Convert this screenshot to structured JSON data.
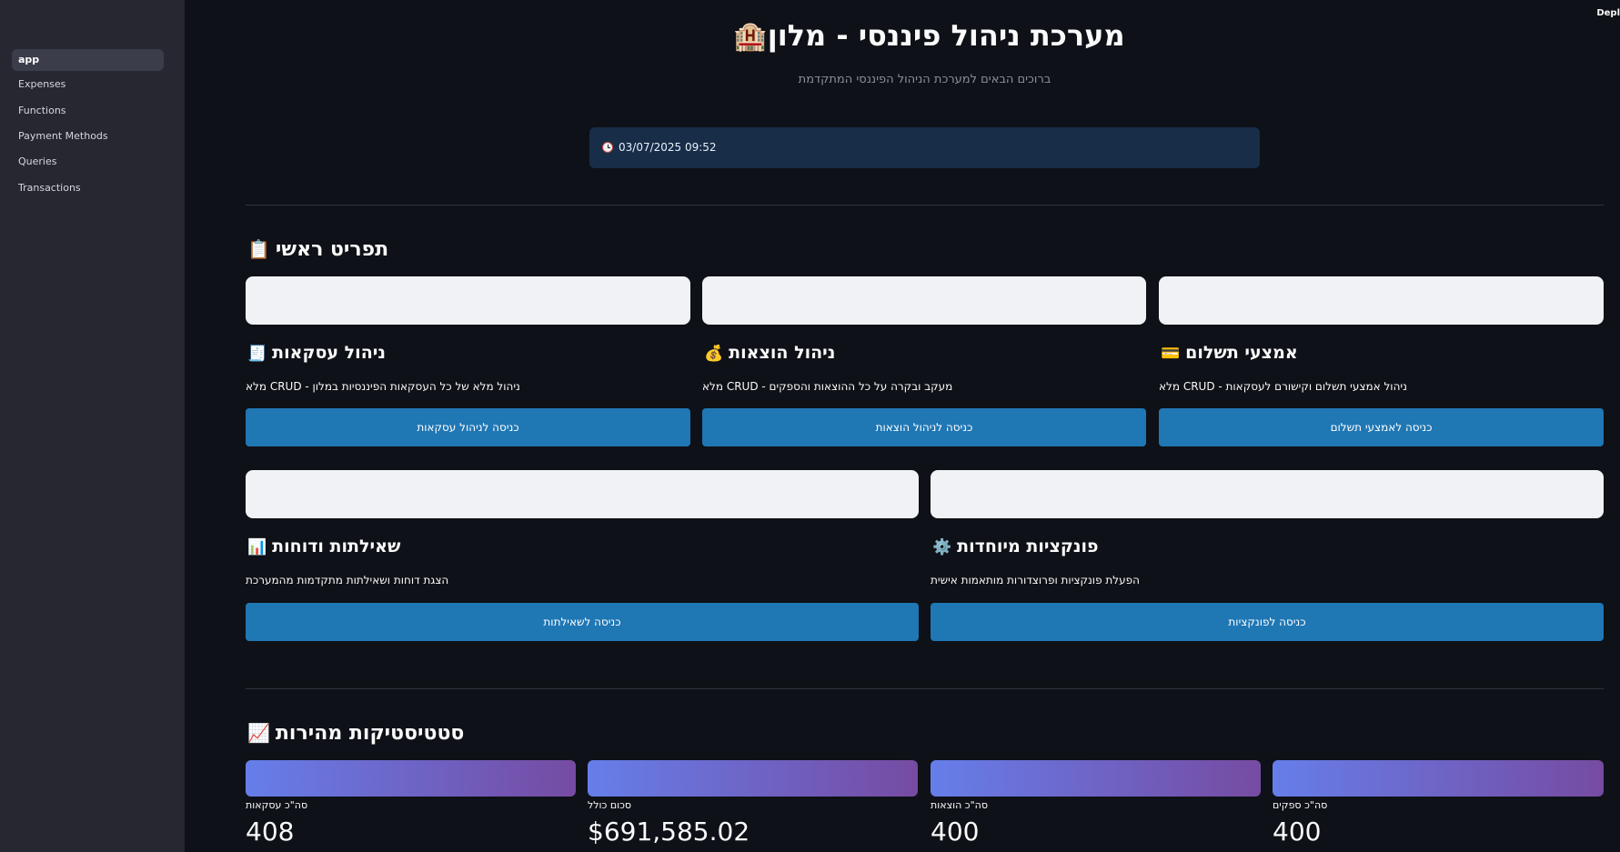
{
  "sidebar": {
    "items": [
      {
        "label": "app",
        "active": true
      },
      {
        "label": "Expenses"
      },
      {
        "label": "Functions"
      },
      {
        "label": "Payment Methods"
      },
      {
        "label": "Queries"
      },
      {
        "label": "Transactions"
      }
    ]
  },
  "header": {
    "deploy_label": "Depl",
    "title": "מערכת ניהול פיננסי - מלון",
    "title_icon": "🏨",
    "subtitle": "ברוכים הבאים למערכת הניהול הפיננסי המתקדמת",
    "datetime": "03/07/2025 09:52"
  },
  "main_menu": {
    "title": "תפריט ראשי",
    "icon": "📋",
    "cards": [
      {
        "title": "ניהול עסקאות",
        "icon": "🧾",
        "desc": "מלא CRUD - ניהול מלא של כל העסקאות הפיננסיות במלון",
        "button": "כניסה לניהול עסקאות"
      },
      {
        "title": "ניהול הוצאות",
        "icon": "💰",
        "desc": "מלא CRUD - מעקב ובקרה על כל ההוצאות והספקים",
        "button": "כניסה לניהול הוצאות"
      },
      {
        "title": "אמצעי תשלום",
        "icon": "💳",
        "desc": "מלא CRUD - ניהול אמצעי תשלום וקישורם לעסקאות",
        "button": "כניסה לאמצעי תשלום"
      },
      {
        "title": "שאילתות ודוחות",
        "icon": "📊",
        "desc": "הצגת דוחות ושאילתות מתקדמות מהמערכת",
        "button": "כניסה לשאילתות"
      },
      {
        "title": "פונקציות מיוחדות",
        "icon": "⚙️",
        "desc": "הפעלת פונקציות ופרוצדורות מותאמות אישית",
        "button": "כניסה לפונקציות"
      }
    ]
  },
  "stats": {
    "title": "סטטיסטיקות מהירות",
    "icon": "📈",
    "metrics": [
      {
        "label": "סה\"כ עסקאות",
        "value": "408"
      },
      {
        "label": "סכום כולל",
        "value": "$691,585.02"
      },
      {
        "label": "סה\"כ הוצאות",
        "value": "400"
      },
      {
        "label": "סה\"כ ספקים",
        "value": "400"
      }
    ]
  },
  "colors": {
    "background": "#0e1117",
    "sidebar": "#262730",
    "button": "#1f77b4",
    "gradient_start": "#667eea",
    "gradient_end": "#764ba2"
  }
}
